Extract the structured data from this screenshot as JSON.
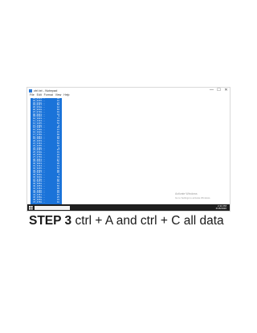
{
  "window": {
    "title": "ctrl.txt - Notepad",
    "menu": [
      "File",
      "Edit",
      "Format",
      "View",
      "Help"
    ],
    "controls": [
      "—",
      "☐",
      "✕"
    ]
  },
  "selection_rows": [
    {
      "k": "01_0114...",
      "v": "38"
    },
    {
      "k": "02_0215...",
      "v": "41"
    },
    {
      "k": "03_0316...",
      "v": "27"
    },
    {
      "k": "04_0417...",
      "v": "55"
    },
    {
      "k": "05_0518...",
      "v": "12"
    },
    {
      "k": "06_0619...",
      "v": "63"
    },
    {
      "k": "07_0720...",
      "v": "19"
    },
    {
      "k": "08_0821...",
      "v": "44"
    },
    {
      "k": "09_0922...",
      "v": "8"
    },
    {
      "k": "10_1023...",
      "v": "71"
    },
    {
      "k": "11_1124...",
      "v": "33"
    },
    {
      "k": "12_1225...",
      "v": "52"
    },
    {
      "k": "13_1326...",
      "v": "6"
    },
    {
      "k": "14_1427...",
      "v": "29"
    },
    {
      "k": "15_1528...",
      "v": "47"
    },
    {
      "k": "16_1629...",
      "v": "15"
    },
    {
      "k": "17_1730...",
      "v": "60"
    },
    {
      "k": "18_1831...",
      "v": "23"
    },
    {
      "k": "19_1932...",
      "v": "38"
    },
    {
      "k": "20_2033...",
      "v": "11"
    },
    {
      "k": "21_2134...",
      "v": "56"
    },
    {
      "k": "22_2235...",
      "v": "42"
    },
    {
      "k": "23_2336...",
      "v": "9"
    },
    {
      "k": "24_2437...",
      "v": "67"
    },
    {
      "k": "25_2538...",
      "v": "31"
    },
    {
      "k": "26_2639...",
      "v": "24"
    },
    {
      "k": "27_2740...",
      "v": "49"
    },
    {
      "k": "28_2841...",
      "v": "17"
    },
    {
      "k": "29_2942...",
      "v": "58"
    },
    {
      "k": "30_3043...",
      "v": "36"
    },
    {
      "k": "31_3144...",
      "v": "13"
    },
    {
      "k": "32_3245...",
      "v": "62"
    },
    {
      "k": "33_3346...",
      "v": "28"
    },
    {
      "k": "34_3447...",
      "v": "45"
    },
    {
      "k": "35_3548...",
      "v": "7"
    },
    {
      "k": "36_3649...",
      "v": "53"
    },
    {
      "k": "37_3750...",
      "v": "21"
    },
    {
      "k": "38_3851...",
      "v": "39"
    },
    {
      "k": "39_3952...",
      "v": "14"
    },
    {
      "k": "40_4053...",
      "v": "66"
    },
    {
      "k": "41_4154...",
      "v": "30"
    },
    {
      "k": "42_4255...",
      "v": "48"
    },
    {
      "k": "43_4356...",
      "v": "10"
    },
    {
      "k": "44_4457...",
      "v": "57"
    },
    {
      "k": "45_4558...",
      "v": "25"
    },
    {
      "k": "46_4659...",
      "v": "43"
    },
    {
      "k": "47_4760...",
      "v": "18"
    }
  ],
  "watermark": {
    "line1": "Activate Windows",
    "line2": "Go to Settings to activate Windows."
  },
  "taskbar": {
    "time": "2:11 PM",
    "date": "4/18/2020"
  },
  "caption": {
    "step": "STEP 3",
    "text": " ctrl + A and ctrl + C all data"
  },
  "colors": {
    "selection": "#1a73d9",
    "taskbar": "#1f1f1f"
  },
  "icons": [
    "notepad-icon",
    "minimize-icon",
    "maximize-icon",
    "close-icon",
    "windows-start-icon",
    "search-box"
  ]
}
